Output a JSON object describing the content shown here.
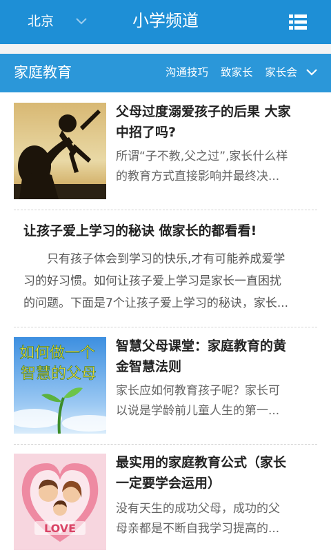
{
  "header": {
    "city": "北京",
    "app_title": "小学频道",
    "city_dropdown_icon": "chevron-down-icon",
    "menu_icon": "list-menu-icon"
  },
  "subheader": {
    "title": "家庭教育",
    "links": [
      "沟通技巧",
      "致家长",
      "家长会"
    ],
    "expand_icon": "chevron-down-icon"
  },
  "articles": [
    {
      "title_line1": "父母过度溺爱孩子的后果 大家",
      "title_line2": "中招了吗?",
      "desc_line1": "所谓“子不教,父之过”,家长什么样",
      "desc_line2": "的教育方式直接影响并最终决..."
    },
    {
      "title": "让孩子爱上学习的秘诀 做家长的都看看!",
      "desc_line1": "只有孩子体会到学习的快乐,才有可能养成爱学",
      "desc_line2": "习的好习惯。如何让孩子爱上学习是家长一直困扰",
      "desc_line3": "的问题。下面是7个让孩子爱上学习的秘诀，家长..."
    },
    {
      "title_line1": "智慧父母课堂：家庭教育的黄",
      "title_line2": "金智慧法则",
      "desc_line1": "家长应如何教育孩子呢？家长可",
      "desc_line2": "以说是学龄前儿童人生的第一...",
      "image_text_line1": "如何做一个",
      "image_text_line2": "智慧的父母"
    },
    {
      "title_line1": "最实用的家庭教育公式（家长",
      "title_line2": "一定要学会运用）",
      "desc_line1": "没有天生的成功父母，成功的父",
      "desc_line2": "母亲都是不断自我学习提高的...",
      "image_text": "LOVE"
    }
  ],
  "colors": {
    "header_bg": "#1e8fd6",
    "subheader_bg": "#2b97d9",
    "title_text": "#222222",
    "desc_text": "#666666"
  }
}
